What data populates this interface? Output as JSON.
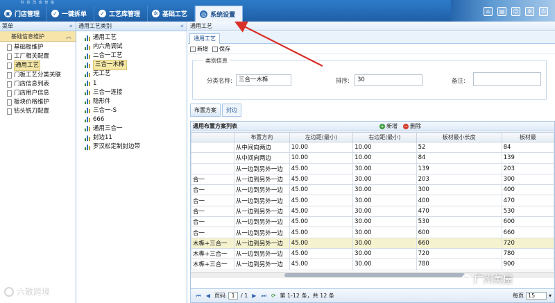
{
  "tagline": "科 技 改 变 智 能",
  "nav_tabs": [
    {
      "label": "门店管理",
      "icon": "store-icon"
    },
    {
      "label": "一键拆单",
      "icon": "check-icon"
    },
    {
      "label": "工艺库管理",
      "icon": "check-icon"
    },
    {
      "label": "基础工艺",
      "icon": "gear-icon"
    },
    {
      "label": "系统设置",
      "icon": "settings-icon",
      "active": true
    }
  ],
  "menu": {
    "title": "菜单",
    "group": "基础信息维护",
    "items": [
      "基础板维护",
      "工厂相关配置",
      "通用工艺",
      "门板工艺分类关联",
      "门店信息列表",
      "门店用户信息",
      "板块价格维护",
      "钻头铣刀配置"
    ],
    "selected_index": 2
  },
  "category": {
    "title": "通用工艺类别",
    "items": [
      "通用工艺",
      "内六角调试",
      "二合一工艺",
      "三合一木榫",
      "无工艺",
      "1",
      "三合一连接",
      "隐形件",
      "三合一-S",
      "666",
      "通用三合一",
      "封边11",
      "罗汉松定制封边带"
    ],
    "selected_index": 3
  },
  "content": {
    "breadcrumb": "通用工艺",
    "tab": "通用工艺",
    "toolbar": {
      "new": "新增",
      "save": "保存"
    },
    "form": {
      "legend": "类别信息",
      "name_label": "分类名称:",
      "name_value": "三合一木榫",
      "sort_label": "排序:",
      "sort_value": "30",
      "remark_label": "备注:",
      "remark_value": ""
    },
    "subtabs": [
      "布置方案",
      "封边"
    ],
    "grid": {
      "title": "通用布置方案列表",
      "add": "新增",
      "delete": "删除",
      "columns": [
        "",
        "布置方向",
        "左边距(最小)",
        "右边距(最小)",
        "板材最小长度",
        "板材最"
      ],
      "rows": [
        [
          "",
          "从中间向两边",
          "10.00",
          "10.00",
          "52",
          "84"
        ],
        [
          "",
          "从中间向两边",
          "10.00",
          "10.00",
          "84",
          "139"
        ],
        [
          "",
          "从一边到另外一边",
          "45.00",
          "30.00",
          "139",
          "203"
        ],
        [
          "合一",
          "从一边到另外一边",
          "45.00",
          "30.00",
          "203",
          "300"
        ],
        [
          "合一",
          "从一边到另外一边",
          "45.00",
          "30.00",
          "300",
          "400"
        ],
        [
          "合一",
          "从一边到另外一边",
          "45.00",
          "30.00",
          "400",
          "470"
        ],
        [
          "合一",
          "从一边到另外一边",
          "45.00",
          "30.00",
          "470",
          "530"
        ],
        [
          "合一",
          "从一边到另外一边",
          "45.00",
          "30.00",
          "530",
          "600"
        ],
        [
          "合一",
          "从一边到另外一边",
          "45.00",
          "30.00",
          "600",
          "660"
        ],
        [
          "木榫+三合一",
          "从一边到另外一边",
          "45.00",
          "30.00",
          "660",
          "720"
        ],
        [
          "木榫+三合一",
          "从一边到另外一边",
          "45.00",
          "30.00",
          "720",
          "780"
        ],
        [
          "木榫+三合一",
          "从一边到另外一边",
          "45.00",
          "30.00",
          "780",
          "900"
        ]
      ],
      "highlight_row": 9
    },
    "pager": {
      "page_label": "页码",
      "page": "1",
      "of": "/ 1",
      "summary": "第 1-12 条，共 12 条",
      "size_label": "每页",
      "size": "15"
    }
  },
  "watermark_left": "六散跨境",
  "watermark_right": "广州美屋",
  "colors": {
    "nav_bg": "#1f5fa6",
    "highlight": "#f5e7a6",
    "arrow": "#d9302a"
  }
}
